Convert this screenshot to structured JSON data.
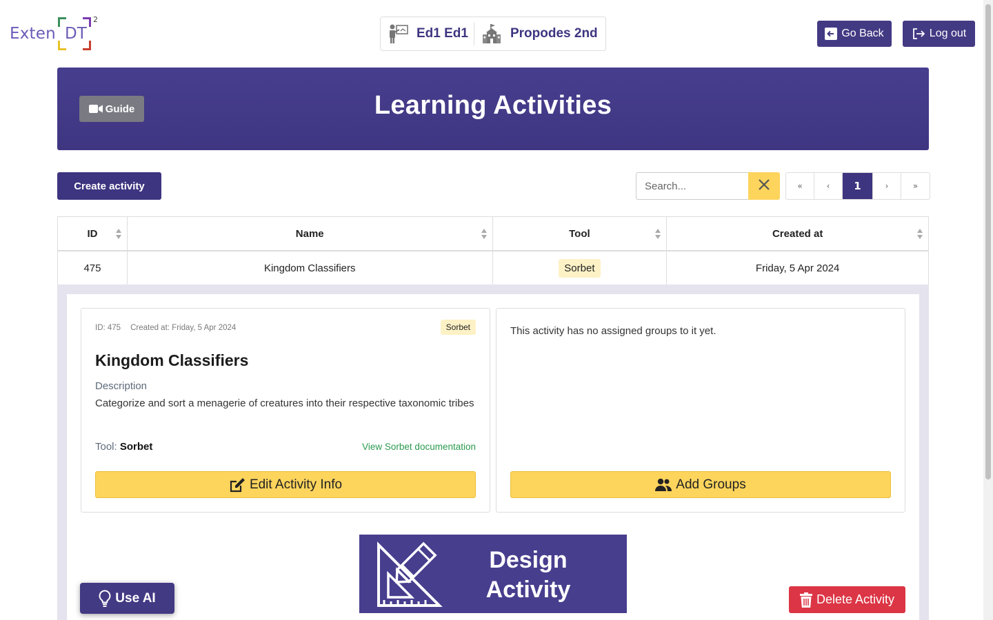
{
  "logo": {
    "text": "Exten",
    "dt": "DT",
    "sup": "2"
  },
  "user": {
    "name": "Ed1 Ed1",
    "school": "Propodes 2nd"
  },
  "header_buttons": {
    "go_back": "Go Back",
    "log_out": "Log out"
  },
  "banner": {
    "guide": "Guide",
    "title": "Learning Activities"
  },
  "toolbar": {
    "create": "Create activity",
    "search_placeholder": "Search...",
    "pager": {
      "first": "«",
      "prev": "‹",
      "current": "1",
      "next": "›",
      "last": "»"
    }
  },
  "table": {
    "headers": {
      "id": "ID",
      "name": "Name",
      "tool": "Tool",
      "created": "Created at"
    },
    "rows": [
      {
        "id": "475",
        "name": "Kingdom Classifiers",
        "tool": "Sorbet",
        "created": "Friday, 5 Apr 2024"
      }
    ]
  },
  "detail": {
    "meta_id": "ID: 475",
    "meta_created": "Created at: Friday, 5 Apr 2024",
    "tool_badge": "Sorbet",
    "title": "Kingdom Classifiers",
    "description_label": "Description",
    "description": "Categorize and sort a menagerie of creatures into their respective taxonomic tribes",
    "tool_label": "Tool:",
    "tool_value": "Sorbet",
    "doc_link": "View Sorbet documentation",
    "edit_button": "Edit Activity Info",
    "no_groups": "This activity has no assigned groups to it yet.",
    "add_groups": "Add Groups",
    "design_line1": "Design",
    "design_line2": "Activity",
    "delete": "Delete Activity"
  },
  "floating": {
    "use_ai": "Use AI"
  },
  "colors": {
    "primary": "#433a84",
    "accent_yellow": "#fdd45c",
    "danger": "#dc3545",
    "link_green": "#2a9a4e"
  }
}
